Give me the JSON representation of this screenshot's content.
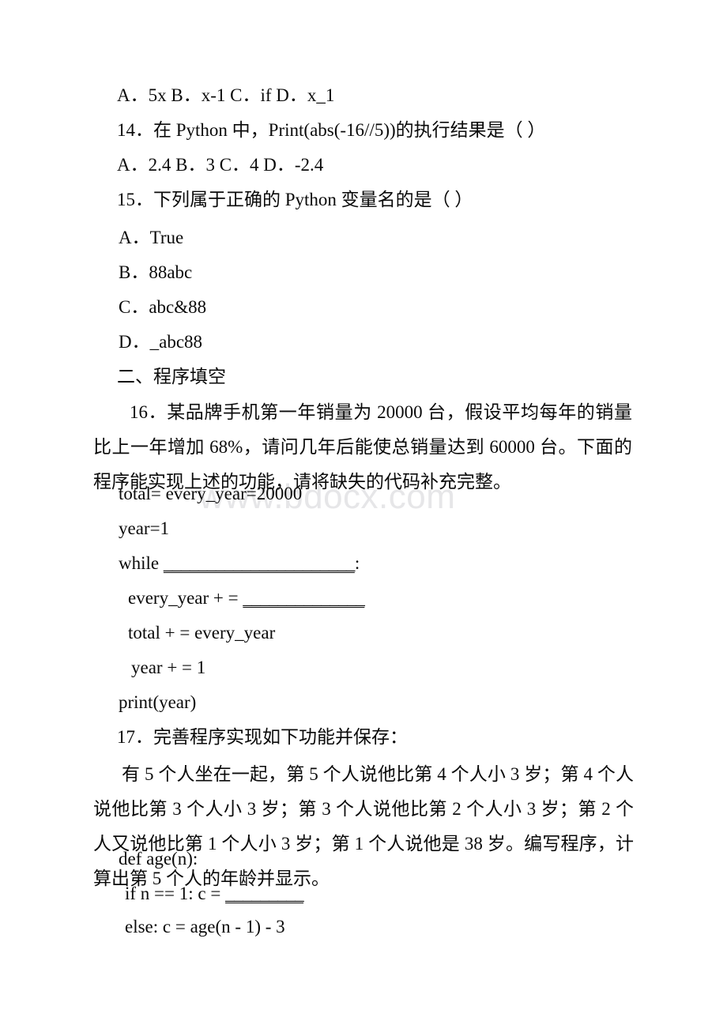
{
  "document": {
    "type": "scanned-exam-page",
    "watermark": "www.bdocx.com",
    "page_background": "#ffffff",
    "text_color": "#0a0a0a",
    "watermark_color": "#e6e6e8"
  },
  "questions": [
    {
      "id": "q13-options",
      "options_line": "A．5x B．x-1 C．if D．x_1"
    },
    {
      "id": "q14",
      "number": "14．",
      "stem": "在 Python 中，Print(abs(-16//5))的执行结果是（ ）",
      "options_line": "A．2.4 B．3 C．4 D．-2.4"
    },
    {
      "id": "q15",
      "number": "15．",
      "stem": "下列属于正确的 Python 变量名的是（ ）",
      "options": [
        "A．True",
        "B．88abc",
        "C．abc&88",
        "D．_abc88"
      ]
    }
  ],
  "section": {
    "heading": "二、程序填空"
  },
  "q16": {
    "number": "16．",
    "body": "某品牌手机第一年销量为 20000 台，假设平均每年的销量比上一年增加 68%，请问几年后能使总销量达到 60000 台。下面的程序能实现上述的功能，请将缺失的代码补充完整。",
    "code": [
      {
        "text": "total= every_year=20000",
        "indent": 0,
        "blank": ""
      },
      {
        "text": "year=1",
        "indent": 0,
        "blank": ""
      },
      {
        "text": "while ",
        "indent": 0,
        "blank": "______________________",
        "tail": ":"
      },
      {
        "text": "every_year + = ",
        "indent": 1,
        "blank": "______________",
        "tail": ""
      },
      {
        "text": "total + = every_year",
        "indent": 1,
        "blank": "",
        "tail": ""
      },
      {
        "text": "year + = 1",
        "indent": 1,
        "blank": "",
        "tail": ""
      },
      {
        "text": "print(year)",
        "indent": 0,
        "blank": "",
        "tail": ""
      }
    ]
  },
  "q17": {
    "number": "17．",
    "title": "完善程序实现如下功能并保存：",
    "body": "有 5 个人坐在一起，第 5 个人说他比第 4 个人小 3 岁；第 4 个人说他比第 3 个人小 3 岁；第 3 个人说他比第 2 个人小 3 岁；第 2 个人又说他比第 1 个人小 3 岁；第 1 个人说他是 38 岁。编写程序，计算出第 5 个人的年龄并显示。",
    "code": [
      {
        "text": "def age(n):",
        "indent": 0,
        "blank": "",
        "tail": ""
      },
      {
        "text": "if n == 1: c = ",
        "indent": 1,
        "blank": "_________",
        "tail": ""
      },
      {
        "text": "else: c = age(n - 1) - 3",
        "indent": 1,
        "blank": "",
        "tail": ""
      }
    ]
  }
}
